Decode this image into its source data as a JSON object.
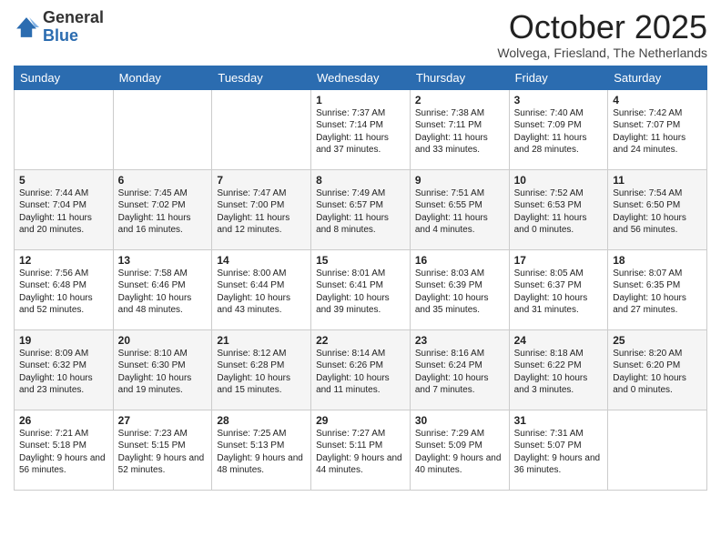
{
  "logo": {
    "general": "General",
    "blue": "Blue"
  },
  "header": {
    "month": "October 2025",
    "location": "Wolvega, Friesland, The Netherlands"
  },
  "weekdays": [
    "Sunday",
    "Monday",
    "Tuesday",
    "Wednesday",
    "Thursday",
    "Friday",
    "Saturday"
  ],
  "weeks": [
    [
      {
        "day": "",
        "info": ""
      },
      {
        "day": "",
        "info": ""
      },
      {
        "day": "",
        "info": ""
      },
      {
        "day": "1",
        "info": "Sunrise: 7:37 AM\nSunset: 7:14 PM\nDaylight: 11 hours and 37 minutes."
      },
      {
        "day": "2",
        "info": "Sunrise: 7:38 AM\nSunset: 7:11 PM\nDaylight: 11 hours and 33 minutes."
      },
      {
        "day": "3",
        "info": "Sunrise: 7:40 AM\nSunset: 7:09 PM\nDaylight: 11 hours and 28 minutes."
      },
      {
        "day": "4",
        "info": "Sunrise: 7:42 AM\nSunset: 7:07 PM\nDaylight: 11 hours and 24 minutes."
      }
    ],
    [
      {
        "day": "5",
        "info": "Sunrise: 7:44 AM\nSunset: 7:04 PM\nDaylight: 11 hours and 20 minutes."
      },
      {
        "day": "6",
        "info": "Sunrise: 7:45 AM\nSunset: 7:02 PM\nDaylight: 11 hours and 16 minutes."
      },
      {
        "day": "7",
        "info": "Sunrise: 7:47 AM\nSunset: 7:00 PM\nDaylight: 11 hours and 12 minutes."
      },
      {
        "day": "8",
        "info": "Sunrise: 7:49 AM\nSunset: 6:57 PM\nDaylight: 11 hours and 8 minutes."
      },
      {
        "day": "9",
        "info": "Sunrise: 7:51 AM\nSunset: 6:55 PM\nDaylight: 11 hours and 4 minutes."
      },
      {
        "day": "10",
        "info": "Sunrise: 7:52 AM\nSunset: 6:53 PM\nDaylight: 11 hours and 0 minutes."
      },
      {
        "day": "11",
        "info": "Sunrise: 7:54 AM\nSunset: 6:50 PM\nDaylight: 10 hours and 56 minutes."
      }
    ],
    [
      {
        "day": "12",
        "info": "Sunrise: 7:56 AM\nSunset: 6:48 PM\nDaylight: 10 hours and 52 minutes."
      },
      {
        "day": "13",
        "info": "Sunrise: 7:58 AM\nSunset: 6:46 PM\nDaylight: 10 hours and 48 minutes."
      },
      {
        "day": "14",
        "info": "Sunrise: 8:00 AM\nSunset: 6:44 PM\nDaylight: 10 hours and 43 minutes."
      },
      {
        "day": "15",
        "info": "Sunrise: 8:01 AM\nSunset: 6:41 PM\nDaylight: 10 hours and 39 minutes."
      },
      {
        "day": "16",
        "info": "Sunrise: 8:03 AM\nSunset: 6:39 PM\nDaylight: 10 hours and 35 minutes."
      },
      {
        "day": "17",
        "info": "Sunrise: 8:05 AM\nSunset: 6:37 PM\nDaylight: 10 hours and 31 minutes."
      },
      {
        "day": "18",
        "info": "Sunrise: 8:07 AM\nSunset: 6:35 PM\nDaylight: 10 hours and 27 minutes."
      }
    ],
    [
      {
        "day": "19",
        "info": "Sunrise: 8:09 AM\nSunset: 6:32 PM\nDaylight: 10 hours and 23 minutes."
      },
      {
        "day": "20",
        "info": "Sunrise: 8:10 AM\nSunset: 6:30 PM\nDaylight: 10 hours and 19 minutes."
      },
      {
        "day": "21",
        "info": "Sunrise: 8:12 AM\nSunset: 6:28 PM\nDaylight: 10 hours and 15 minutes."
      },
      {
        "day": "22",
        "info": "Sunrise: 8:14 AM\nSunset: 6:26 PM\nDaylight: 10 hours and 11 minutes."
      },
      {
        "day": "23",
        "info": "Sunrise: 8:16 AM\nSunset: 6:24 PM\nDaylight: 10 hours and 7 minutes."
      },
      {
        "day": "24",
        "info": "Sunrise: 8:18 AM\nSunset: 6:22 PM\nDaylight: 10 hours and 3 minutes."
      },
      {
        "day": "25",
        "info": "Sunrise: 8:20 AM\nSunset: 6:20 PM\nDaylight: 10 hours and 0 minutes."
      }
    ],
    [
      {
        "day": "26",
        "info": "Sunrise: 7:21 AM\nSunset: 5:18 PM\nDaylight: 9 hours and 56 minutes."
      },
      {
        "day": "27",
        "info": "Sunrise: 7:23 AM\nSunset: 5:15 PM\nDaylight: 9 hours and 52 minutes."
      },
      {
        "day": "28",
        "info": "Sunrise: 7:25 AM\nSunset: 5:13 PM\nDaylight: 9 hours and 48 minutes."
      },
      {
        "day": "29",
        "info": "Sunrise: 7:27 AM\nSunset: 5:11 PM\nDaylight: 9 hours and 44 minutes."
      },
      {
        "day": "30",
        "info": "Sunrise: 7:29 AM\nSunset: 5:09 PM\nDaylight: 9 hours and 40 minutes."
      },
      {
        "day": "31",
        "info": "Sunrise: 7:31 AM\nSunset: 5:07 PM\nDaylight: 9 hours and 36 minutes."
      },
      {
        "day": "",
        "info": ""
      }
    ]
  ]
}
